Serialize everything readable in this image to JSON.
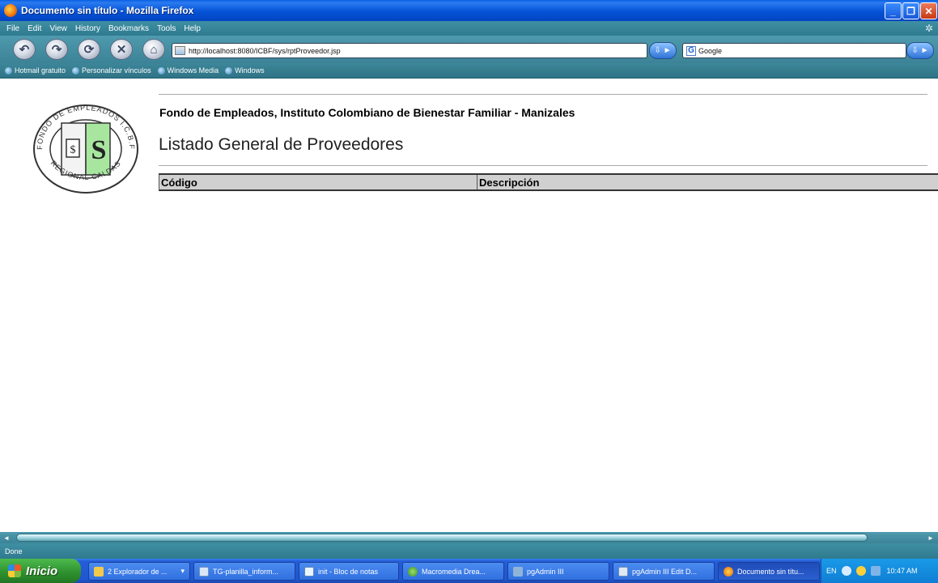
{
  "window": {
    "title": "Documento sin título - Mozilla Firefox"
  },
  "menu": [
    "File",
    "Edit",
    "View",
    "History",
    "Bookmarks",
    "Tools",
    "Help"
  ],
  "nav": {
    "url": "http://localhost:8080/ICBF/sys/rptProveedor.jsp",
    "search_engine": "Google",
    "buttons": [
      "back-icon",
      "forward-icon",
      "reload-icon",
      "stop-icon",
      "home-icon"
    ]
  },
  "bookmarks": [
    "Hotmail gratuito",
    "Personalizar vínculos",
    "Windows Media",
    "Windows"
  ],
  "page": {
    "org_title": "Fondo de Empleados, Instituto Colombiano de Bienestar Familiar - Manizales",
    "heading": "Listado General de Proveedores",
    "table": {
      "columns": [
        "Código",
        "Descripción"
      ],
      "rows": []
    },
    "logo": {
      "top_text": "FONDO DE EMPLEADOS I.C.B.F",
      "bottom_text": "REGIONAL CALDAS",
      "center_text": "$ S S"
    }
  },
  "status": {
    "text": "Done"
  },
  "taskbar": {
    "start_label": "Inicio",
    "tasks": [
      "2 Explorador de ...",
      "TG-planilla_inform...",
      "init - Bloc de notas",
      "Macromedia Drea...",
      "pgAdmin III",
      "pgAdmin III Edit D...",
      "Documento sin títu..."
    ],
    "lang": "EN",
    "clock": "10:47 AM"
  },
  "colors": {
    "titlebar": "#0553d6",
    "chrome": "#3c8397",
    "table_header": "#d0d0d0",
    "start": "#2d8f2d"
  }
}
